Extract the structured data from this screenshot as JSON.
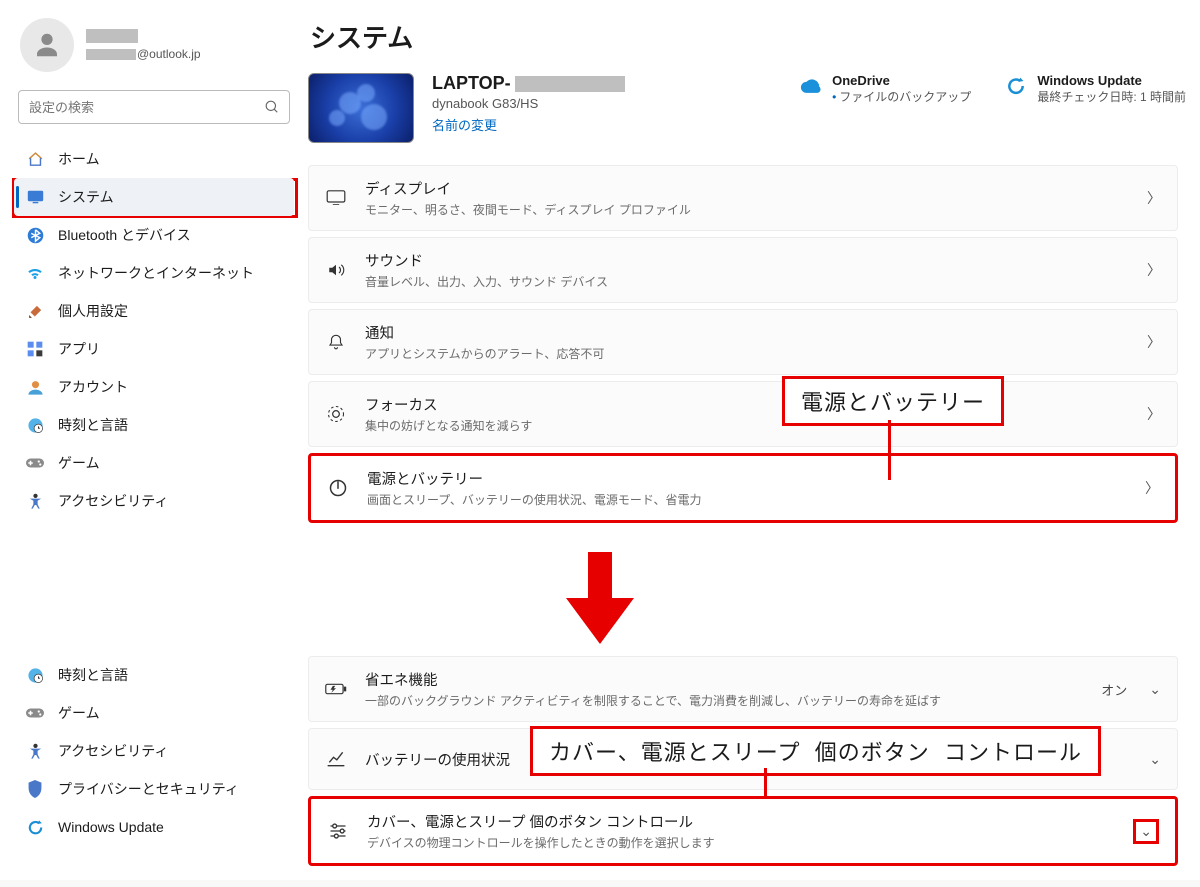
{
  "account": {
    "email_suffix": "@outlook.jp"
  },
  "search": {
    "placeholder": "設定の検索"
  },
  "nav": {
    "items": [
      {
        "key": "home",
        "label": "ホーム"
      },
      {
        "key": "system",
        "label": "システム"
      },
      {
        "key": "bluetooth",
        "label": "Bluetooth とデバイス"
      },
      {
        "key": "network",
        "label": "ネットワークとインターネット"
      },
      {
        "key": "personalize",
        "label": "個人用設定"
      },
      {
        "key": "apps",
        "label": "アプリ"
      },
      {
        "key": "account",
        "label": "アカウント"
      },
      {
        "key": "time",
        "label": "時刻と言語"
      },
      {
        "key": "game",
        "label": "ゲーム"
      },
      {
        "key": "access",
        "label": "アクセシビリティ"
      }
    ]
  },
  "nav2": {
    "items": [
      {
        "key": "time",
        "label": "時刻と言語"
      },
      {
        "key": "game",
        "label": "ゲーム"
      },
      {
        "key": "access",
        "label": "アクセシビリティ"
      },
      {
        "key": "privacy",
        "label": "プライバシーとセキュリティ"
      },
      {
        "key": "update",
        "label": "Windows Update"
      }
    ]
  },
  "page_title": "システム",
  "device": {
    "name_prefix": "LAPTOP-",
    "model": "dynabook G83/HS",
    "rename": "名前の変更"
  },
  "cloud": {
    "onedrive": {
      "title": "OneDrive",
      "sub": "ファイルのバックアップ"
    },
    "update": {
      "title": "Windows Update",
      "sub": "最終チェック日時: 1 時間前"
    }
  },
  "rows": {
    "display": {
      "title": "ディスプレイ",
      "sub": "モニター、明るさ、夜間モード、ディスプレイ プロファイル"
    },
    "sound": {
      "title": "サウンド",
      "sub": "音量レベル、出力、入力、サウンド デバイス"
    },
    "notify": {
      "title": "通知",
      "sub": "アプリとシステムからのアラート、応答不可"
    },
    "focus": {
      "title": "フォーカス",
      "sub": "集中の妨げとなる通知を減らす"
    },
    "power": {
      "title": "電源とバッテリー",
      "sub": "画面とスリープ、バッテリーの使用状況、電源モード、省電力"
    }
  },
  "rows2": {
    "eco": {
      "title": "省エネ機能",
      "sub": "一部のバックグラウンド アクティビティを制限することで、電力消費を削減し、バッテリーの寿命を延ばす",
      "status": "オン"
    },
    "battery": {
      "title": "バッテリーの使用状況"
    },
    "lid": {
      "title": "カバー、電源とスリープ 個のボタン コントロール",
      "sub": "デバイスの物理コントロールを操作したときの動作を選択します"
    }
  },
  "callouts": {
    "power": "電源とバッテリー",
    "lid": "カバー、電源とスリープ 個のボタン コントロール"
  }
}
